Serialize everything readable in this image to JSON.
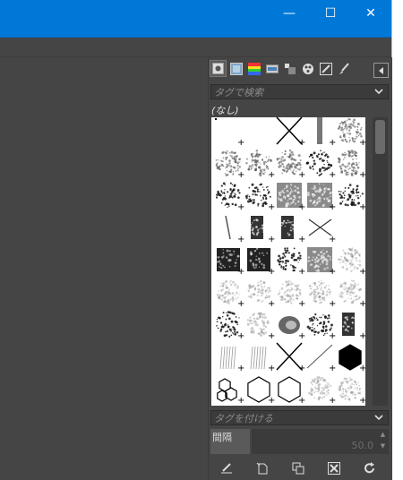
{
  "window": {
    "minimize_glyph": "—",
    "maximize_glyph": "☐",
    "close_glyph": "✕"
  },
  "brushes_panel": {
    "tabs": [
      "brushes-tab",
      "patterns-tab",
      "gradients-tab",
      "palettes-tab",
      "fonts-tab",
      "tool-presets-tab",
      "paint-dynamics-tab",
      "mypaint-brushes-tab"
    ],
    "search_placeholder": "タグで検索",
    "current_brush": "(なし)",
    "tag_placeholder": "タグを付ける",
    "spacing_label": "間隔",
    "spacing_value": "50.0",
    "brush_grid": [
      "pixel",
      "blank",
      "cross",
      "bar",
      "sponge",
      "sponge",
      "sponge",
      "sponge",
      "splatter",
      "sponge",
      "splatter",
      "splatter",
      "texture",
      "texture",
      "splatter",
      "hairline",
      "chalk",
      "chalk",
      "cross-thin",
      "blank",
      "charcoal",
      "charcoal",
      "splatter",
      "texture",
      "blur",
      "blur",
      "blur",
      "blur",
      "blur",
      "blur",
      "splatter",
      "blur",
      "swirl",
      "splatter",
      "chalk",
      "grass",
      "grass",
      "cross",
      "diag-line",
      "hexagon-filled",
      "hexagons-small",
      "hexagon",
      "hexagon",
      "blur",
      "blur",
      "blur",
      "blur",
      "blur",
      "blur",
      "blur"
    ],
    "bottom_actions": [
      "edit-brush-icon",
      "new-brush-icon",
      "duplicate-brush-icon",
      "delete-brush-icon",
      "refresh-brushes-icon"
    ]
  }
}
